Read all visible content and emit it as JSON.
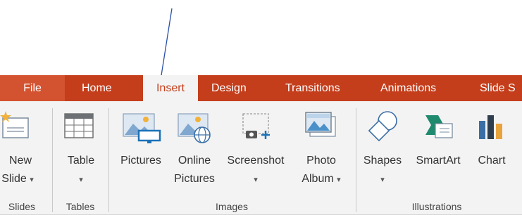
{
  "tabs": {
    "file": "File",
    "home": "Home",
    "insert": "Insert",
    "design": "Design",
    "transitions": "Transitions",
    "animations": "Animations",
    "slideshow": "Slide S"
  },
  "buttons": {
    "new_slide": {
      "line1": "New",
      "line2": "Slide",
      "icon": "new-slide-icon"
    },
    "table": {
      "line1": "Table",
      "icon": "table-icon"
    },
    "pictures": {
      "line1": "Pictures",
      "icon": "pictures-icon"
    },
    "online_pictures": {
      "line1": "Online",
      "line2": "Pictures",
      "icon": "online-pictures-icon"
    },
    "screenshot": {
      "line1": "Screenshot",
      "icon": "screenshot-icon"
    },
    "photo_album": {
      "line1": "Photo",
      "line2": "Album",
      "icon": "photo-album-icon"
    },
    "shapes": {
      "line1": "Shapes",
      "icon": "shapes-icon"
    },
    "smartart": {
      "line1": "SmartArt",
      "icon": "smartart-icon"
    },
    "chart": {
      "line1": "Chart",
      "icon": "chart-icon"
    }
  },
  "groups": {
    "slides": "Slides",
    "tables": "Tables",
    "images": "Images",
    "illustrations": "Illustrations"
  },
  "dropdown_caret": "▾",
  "colors": {
    "tab_bar": "#c43e1c",
    "file_tab": "#d35230",
    "ribbon": "#f3f3f3",
    "annotation_arrow": "#2b4fa8"
  }
}
